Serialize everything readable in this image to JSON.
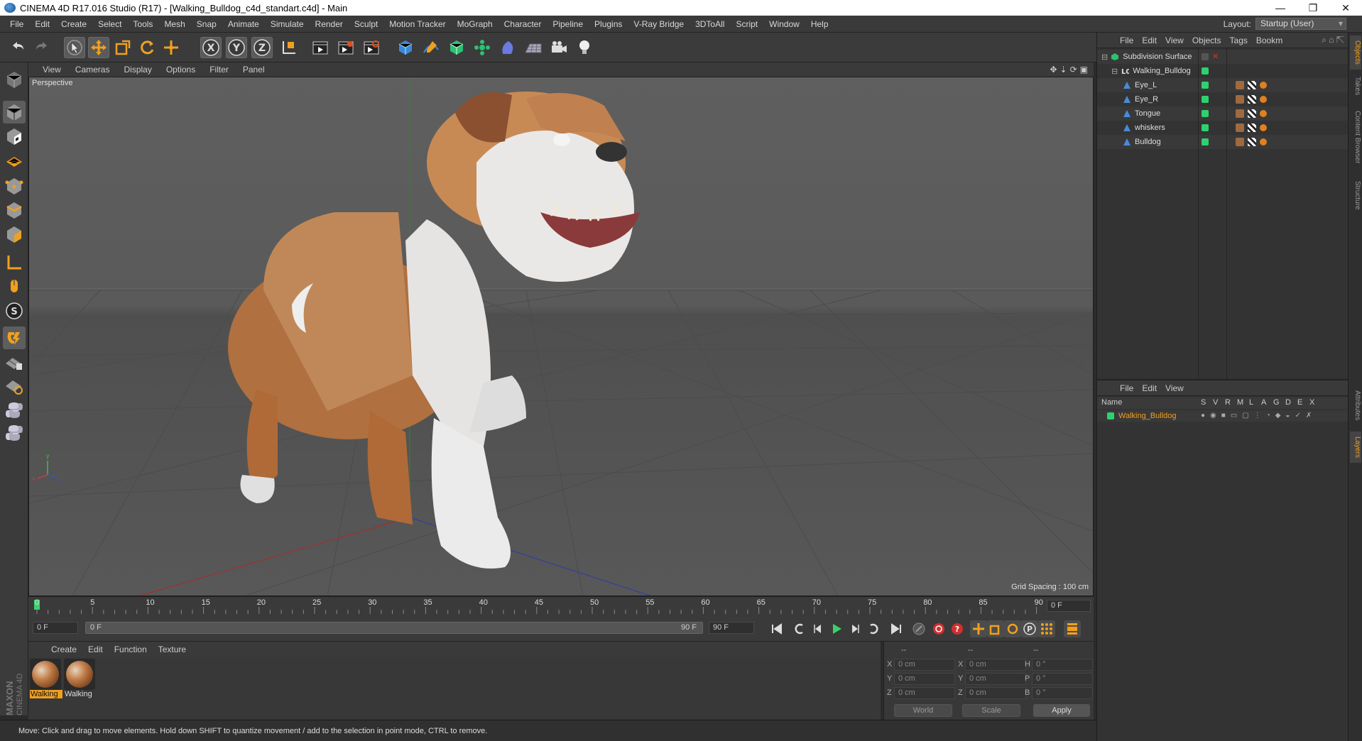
{
  "window": {
    "title": "CINEMA 4D R17.016 Studio (R17) - [Walking_Bulldog_c4d_standart.c4d] - Main",
    "controls": [
      "—",
      "❐",
      "✕"
    ]
  },
  "menubar": {
    "items": [
      "File",
      "Edit",
      "Create",
      "Select",
      "Tools",
      "Mesh",
      "Snap",
      "Animate",
      "Simulate",
      "Render",
      "Sculpt",
      "Motion Tracker",
      "MoGraph",
      "Character",
      "Pipeline",
      "Plugins",
      "V-Ray Bridge",
      "3DToAll",
      "Script",
      "Window",
      "Help"
    ],
    "layout_label": "Layout:",
    "layout_value": "Startup (User)"
  },
  "toolbar": {
    "icons": [
      "undo-icon",
      "redo-icon",
      "select-arrow-icon",
      "move-icon",
      "scale-icon",
      "rotate-icon",
      "live-select-icon",
      "x-axis-icon",
      "y-axis-icon",
      "z-axis-icon",
      "coordinate-system-icon",
      "render-view-icon",
      "render-picture-viewer-icon",
      "edit-render-settings-icon",
      "cube-icon",
      "pen-spline-icon",
      "subdivision-icon",
      "array-icon",
      "deformer-icon",
      "floor-icon",
      "camera-icon",
      "light-icon"
    ]
  },
  "left_toolbar": {
    "icons": [
      "make-editable-icon",
      "model-mode-icon",
      "texture-mode-icon",
      "workplane-icon",
      "points-mode-icon",
      "edges-mode-icon",
      "polygons-mode-icon",
      "axis-mode-icon",
      "tweak-mode-icon",
      "snap-icon",
      "magnet-icon",
      "grid-lock-icon",
      "snap-settings-icon",
      "python-icon",
      "python-script-icon"
    ]
  },
  "viewport": {
    "menu": [
      "View",
      "Cameras",
      "Display",
      "Options",
      "Filter",
      "Panel"
    ],
    "camera_label": "Perspective",
    "grid_spacing": "Grid Spacing : 100 cm"
  },
  "timeline": {
    "ticks": [
      "0",
      "5",
      "10",
      "15",
      "20",
      "25",
      "30",
      "35",
      "40",
      "45",
      "50",
      "55",
      "60",
      "65",
      "70",
      "75",
      "80",
      "85",
      "90"
    ],
    "current_frame": "0 F",
    "start_field": "0 F",
    "range_start": "0 F",
    "range_end": "90 F",
    "end_field": "90 F"
  },
  "material_manager": {
    "menu": [
      "Create",
      "Edit",
      "Function",
      "Texture"
    ],
    "materials": [
      {
        "label": "Walking",
        "selected": true
      },
      {
        "label": "Walking",
        "selected": false
      }
    ]
  },
  "coordinates": {
    "headers": [
      "--",
      "--",
      "--"
    ],
    "rows": [
      {
        "axis": "X",
        "pos": "0 cm",
        "axis2": "X",
        "size": "0 cm",
        "rot_label": "H",
        "rot": "0 °"
      },
      {
        "axis": "Y",
        "pos": "0 cm",
        "axis2": "Y",
        "size": "0 cm",
        "rot_label": "P",
        "rot": "0 °"
      },
      {
        "axis": "Z",
        "pos": "0 cm",
        "axis2": "Z",
        "size": "0 cm",
        "rot_label": "B",
        "rot": "0 °"
      }
    ],
    "world": "World",
    "scale": "Scale",
    "apply": "Apply"
  },
  "status": {
    "text": "Move: Click and drag to move elements. Hold down SHIFT to quantize movement / add to the selection in point mode, CTRL to remove."
  },
  "object_manager": {
    "menu": [
      "File",
      "Edit",
      "View",
      "Objects",
      "Tags",
      "Bookm"
    ],
    "objects": [
      {
        "name": "Subdivision Surface",
        "level": 0
      },
      {
        "name": "Walking_Bulldog",
        "level": 1
      },
      {
        "name": "Eye_L",
        "level": 2
      },
      {
        "name": "Eye_R",
        "level": 2
      },
      {
        "name": "Tongue",
        "level": 2
      },
      {
        "name": "whiskers",
        "level": 2
      },
      {
        "name": "Bulldog",
        "level": 2
      }
    ]
  },
  "layer_manager": {
    "menu": [
      "File",
      "Edit",
      "View"
    ],
    "columns": [
      "Name",
      "S",
      "V",
      "R",
      "M",
      "L",
      "A",
      "G",
      "D",
      "E",
      "X"
    ],
    "layers": [
      {
        "name": "Walking_Bulldog",
        "color": "#2ed16e"
      }
    ]
  },
  "side_tabs": [
    "Objects",
    "Takes",
    "Content Browser",
    "Structure",
    "Attributes",
    "Layers"
  ],
  "colors": {
    "accent": "#f0a020",
    "green": "#2ed16e",
    "x_axis": "#c03030",
    "y_axis": "#30a030",
    "z_axis": "#3040c0"
  },
  "branding": "MAXON CINEMA 4D"
}
